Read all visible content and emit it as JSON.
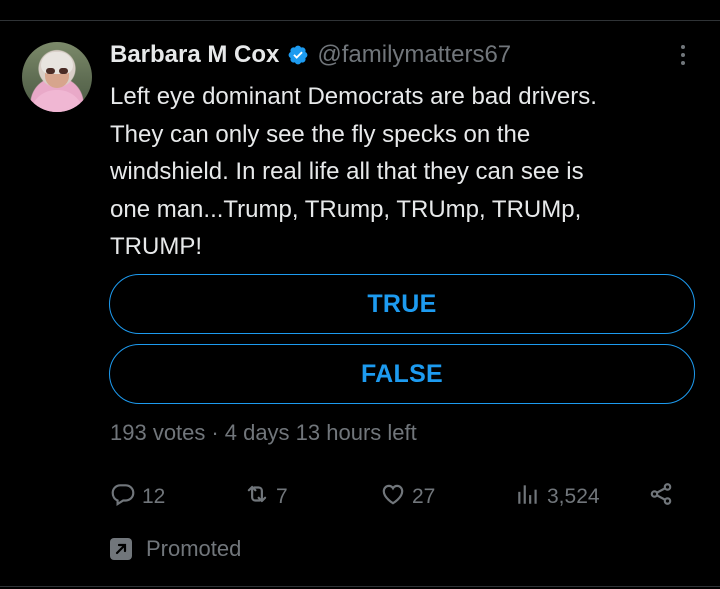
{
  "author": {
    "name": "Barbara M Cox",
    "handle": "@familymatters67",
    "verified": true
  },
  "tweet": {
    "text": "Left eye dominant Democrats are bad drivers.\nThey can only see the fly specks on the\nwindshield. In real life all that they can  see is\none man...Trump, TRump, TRUmp, TRUMp,\nTRUMP!"
  },
  "poll": {
    "options": [
      "TRUE",
      "FALSE"
    ],
    "votes": "193 votes",
    "separator": "·",
    "time_left": "4 days 13 hours left"
  },
  "actions": {
    "replies": "12",
    "reposts": "7",
    "likes": "27",
    "views": "3,524"
  },
  "promoted_label": "Promoted",
  "colors": {
    "accent": "#1d9bf0",
    "muted": "#71767b",
    "text": "#e7e9ea",
    "background": "#000000"
  },
  "icons": [
    "verified-badge-icon",
    "more-icon",
    "reply-icon",
    "retweet-icon",
    "like-icon",
    "views-icon",
    "share-icon",
    "promoted-icon"
  ]
}
